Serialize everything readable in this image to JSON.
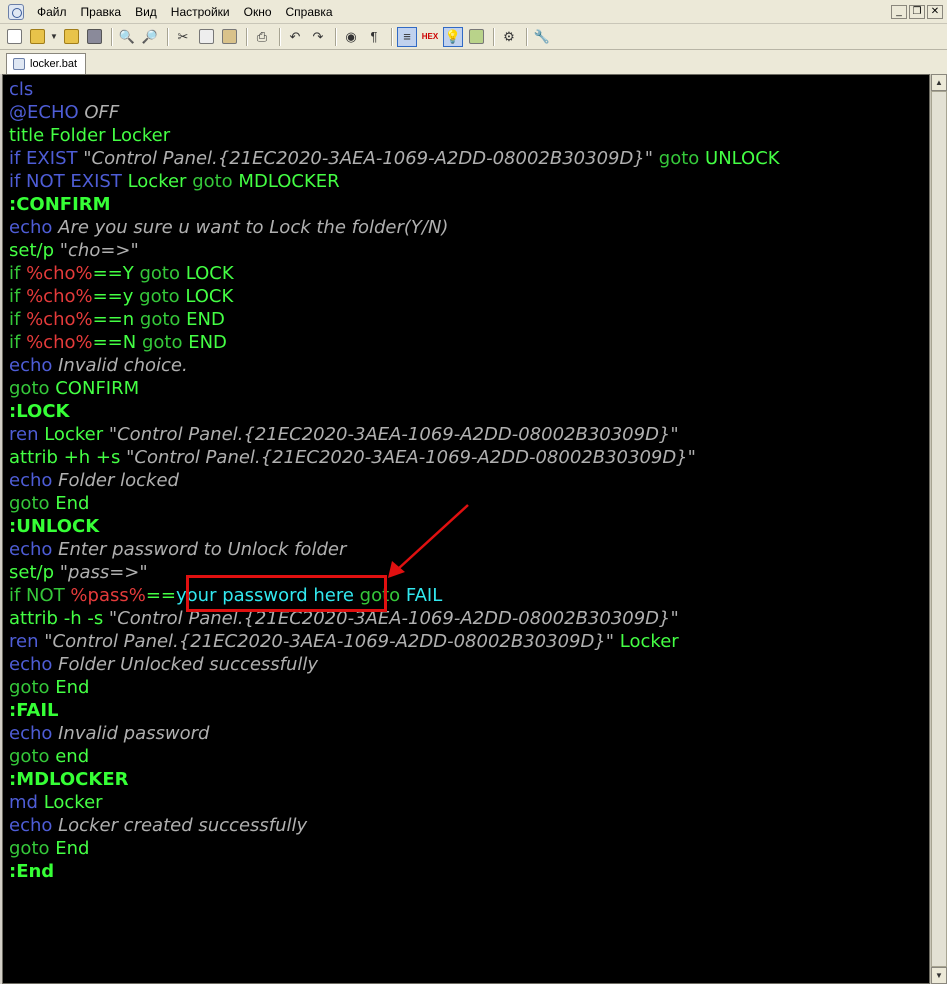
{
  "menu": {
    "items": [
      "Файл",
      "Правка",
      "Вид",
      "Настройки",
      "Окно",
      "Справка"
    ]
  },
  "window_buttons": {
    "minimize": "_",
    "restore": "❐",
    "close": "✕"
  },
  "tab": {
    "label": "locker.bat"
  },
  "colors": {
    "editor_background": "#000000",
    "annotation_red": "#e01010",
    "keyword_blue": "#4e5dd6",
    "label_green": "#36ff36",
    "variable_red": "#e53b3b",
    "string_gray": "#b0b0b0",
    "highlight_cyan": "#32e8ef"
  },
  "code": {
    "lines": [
      [
        [
          "kw",
          "cls"
        ]
      ],
      [
        [
          "kw",
          "@ECHO"
        ],
        [
          "str",
          " OFF"
        ]
      ],
      [
        [
          "plain",
          "title Folder Locker"
        ]
      ],
      [
        [
          "kw",
          "if EXIST "
        ],
        [
          "str",
          "\"Control Panel.{21EC2020-3AEA-1069-A2DD-08002B30309D}\""
        ],
        [
          "kwg",
          " goto"
        ],
        [
          "plain",
          " UNLOCK"
        ]
      ],
      [
        [
          "kw",
          "if NOT EXIST "
        ],
        [
          "plain",
          "Locker"
        ],
        [
          "kwg",
          " goto"
        ],
        [
          "plain",
          " MDLOCKER"
        ]
      ],
      [
        [
          "lbl",
          ":CONFIRM"
        ]
      ],
      [
        [
          "kw",
          "echo"
        ],
        [
          "str",
          " Are you sure u want to Lock the folder(Y/N)"
        ]
      ],
      [
        [
          "plain",
          "set/p "
        ],
        [
          "str",
          "\"cho=>\""
        ]
      ],
      [
        [
          "kwg",
          "if "
        ],
        [
          "var",
          "%cho%"
        ],
        [
          "plain",
          "==Y"
        ],
        [
          "kwg",
          " goto"
        ],
        [
          "plain",
          " LOCK"
        ]
      ],
      [
        [
          "kwg",
          "if "
        ],
        [
          "var",
          "%cho%"
        ],
        [
          "plain",
          "==y"
        ],
        [
          "kwg",
          " goto"
        ],
        [
          "plain",
          " LOCK"
        ]
      ],
      [
        [
          "kwg",
          "if "
        ],
        [
          "var",
          "%cho%"
        ],
        [
          "plain",
          "==n"
        ],
        [
          "kwg",
          " goto"
        ],
        [
          "plain",
          " END"
        ]
      ],
      [
        [
          "kwg",
          "if "
        ],
        [
          "var",
          "%cho%"
        ],
        [
          "plain",
          "==N"
        ],
        [
          "kwg",
          " goto"
        ],
        [
          "plain",
          " END"
        ]
      ],
      [
        [
          "kw",
          "echo"
        ],
        [
          "str",
          " Invalid choice."
        ]
      ],
      [
        [
          "kwg",
          "goto"
        ],
        [
          "plain",
          " CONFIRM"
        ]
      ],
      [
        [
          "lbl",
          ":LOCK"
        ]
      ],
      [
        [
          "kw",
          "ren"
        ],
        [
          "plain",
          " Locker "
        ],
        [
          "str",
          "\"Control Panel.{21EC2020-3AEA-1069-A2DD-08002B30309D}\""
        ]
      ],
      [
        [
          "plain",
          "attrib +h +s "
        ],
        [
          "str",
          "\"Control Panel.{21EC2020-3AEA-1069-A2DD-08002B30309D}\""
        ]
      ],
      [
        [
          "kw",
          "echo"
        ],
        [
          "str",
          " Folder locked"
        ]
      ],
      [
        [
          "kwg",
          "goto"
        ],
        [
          "plain",
          " End"
        ]
      ],
      [
        [
          "lbl",
          ":UNLOCK"
        ]
      ],
      [
        [
          "kw",
          "echo"
        ],
        [
          "str",
          " Enter password to Unlock folder"
        ]
      ],
      [
        [
          "plain",
          "set/p "
        ],
        [
          "str",
          "\"pass=>\""
        ]
      ],
      [
        [
          "kwg",
          "if NOT "
        ],
        [
          "var",
          "%pass%"
        ],
        [
          "plain",
          "=="
        ],
        [
          "cyan",
          "your password here"
        ],
        [
          "kwg",
          " goto"
        ],
        [
          "cyan",
          " FAIL"
        ]
      ],
      [
        [
          "plain",
          "attrib -h -s "
        ],
        [
          "str",
          "\"Control Panel.{21EC2020-3AEA-1069-A2DD-08002B30309D}\""
        ]
      ],
      [
        [
          "kw",
          "ren "
        ],
        [
          "str",
          "\"Control Panel.{21EC2020-3AEA-1069-A2DD-08002B30309D}\""
        ],
        [
          "plain",
          " Locker"
        ]
      ],
      [
        [
          "kw",
          "echo"
        ],
        [
          "str",
          " Folder Unlocked successfully"
        ]
      ],
      [
        [
          "kwg",
          "goto"
        ],
        [
          "plain",
          " End"
        ]
      ],
      [
        [
          "lbl",
          ":FAIL"
        ]
      ],
      [
        [
          "kw",
          "echo"
        ],
        [
          "str",
          " Invalid password"
        ]
      ],
      [
        [
          "kwg",
          "goto"
        ],
        [
          "plain",
          " end"
        ]
      ],
      [
        [
          "lbl",
          ":MDLOCKER"
        ]
      ],
      [
        [
          "kw",
          "md"
        ],
        [
          "plain",
          " Locker"
        ]
      ],
      [
        [
          "kw",
          "echo"
        ],
        [
          "str",
          " Locker created successfully"
        ]
      ],
      [
        [
          "kwg",
          "goto"
        ],
        [
          "plain",
          " End"
        ]
      ],
      [
        [
          "lbl",
          ":End"
        ]
      ]
    ]
  }
}
